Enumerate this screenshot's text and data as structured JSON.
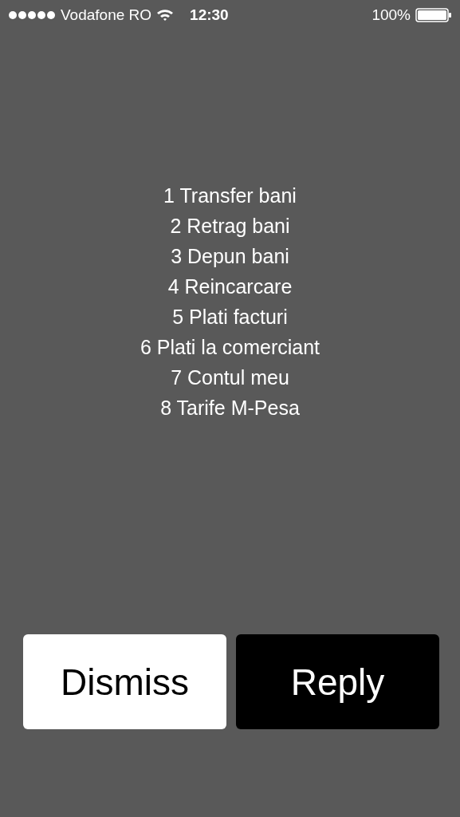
{
  "status_bar": {
    "carrier": "Vodafone RO",
    "time": "12:30",
    "battery_text": "100%"
  },
  "menu_lines": [
    "1 Transfer bani",
    "2 Retrag bani",
    "3 Depun bani",
    "4 Reincarcare",
    "5 Plati facturi",
    "6 Plati la comerciant",
    "7 Contul meu",
    "8 Tarife M-Pesa"
  ],
  "buttons": [
    {
      "label": "Dismiss",
      "kind": "light"
    },
    {
      "label": "Reply",
      "kind": "dark"
    }
  ]
}
